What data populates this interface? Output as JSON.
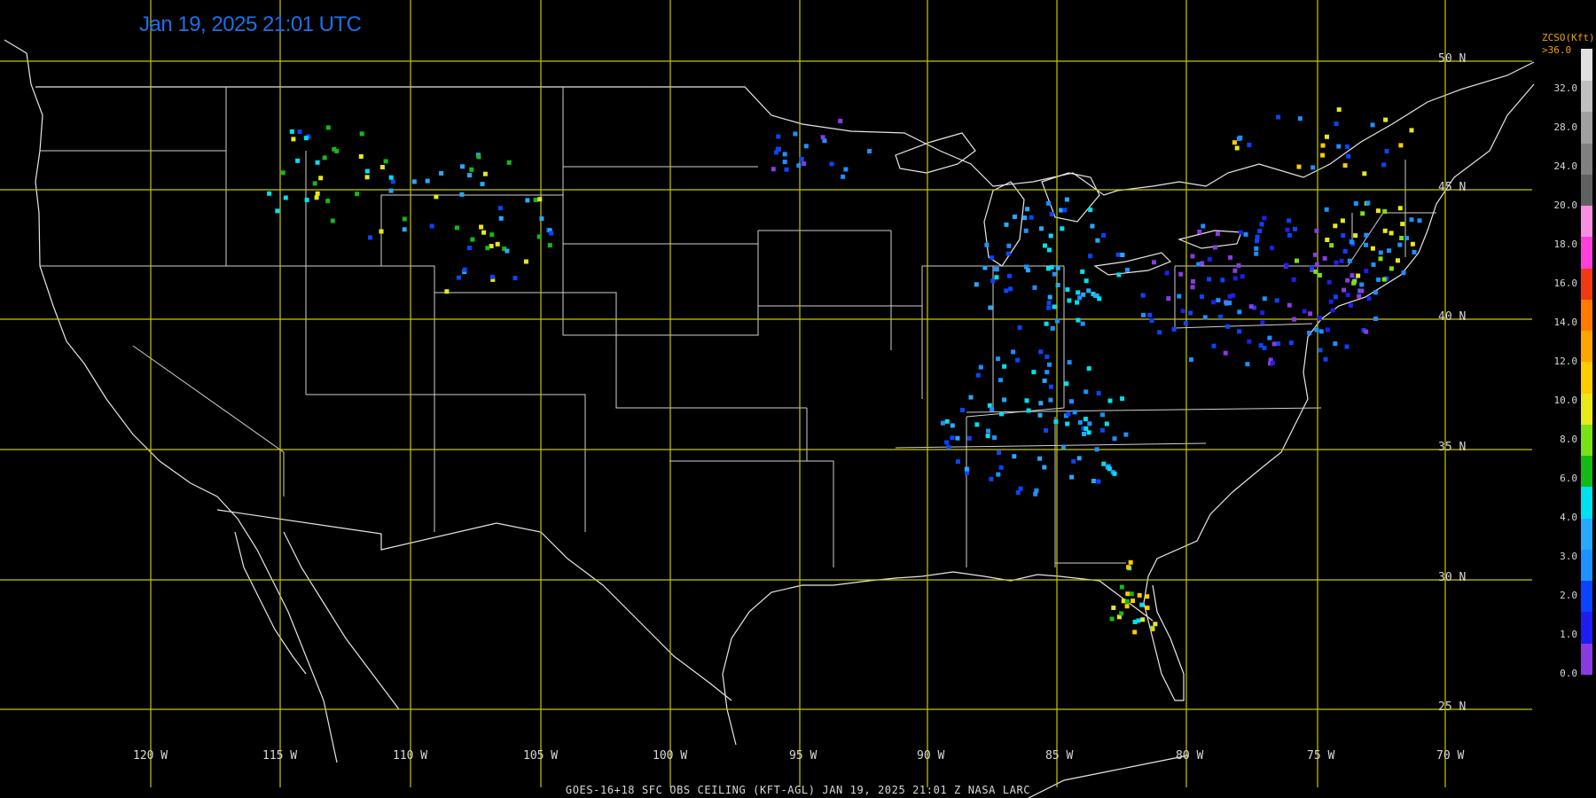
{
  "timestamp": "Jan 19, 2025 21:01 UTC",
  "footer": "GOES-16+18  SFC OBS CEILING (KFT-AGL)   JAN 19, 2025 21:01 Z   NASA LARC",
  "legend": {
    "title": "ZCSO(Kft)",
    "max_label": ">36.0",
    "ticks": [
      "32.0",
      "28.0",
      "24.0",
      "20.0",
      "18.0",
      "16.0",
      "14.0",
      "12.0",
      "10.0",
      "8.0",
      "6.0",
      "4.0",
      "3.0",
      "2.0",
      "1.0",
      "0.0"
    ],
    "colors": [
      "#8a3be0",
      "#1e1ef0",
      "#0a44ff",
      "#1e90ff",
      "#28a8ff",
      "#00e0f0",
      "#16b816",
      "#7ae01a",
      "#e8e81a",
      "#ffcc00",
      "#ffa500",
      "#ff7a00",
      "#f03a14",
      "#ff40d8",
      "#f890e0",
      "#606060",
      "#808080",
      "#a0a0a0",
      "#c0c0c0",
      "#e0e0e0"
    ]
  },
  "grid": {
    "lat_labels": [
      "50 N",
      "45 N",
      "40 N",
      "35 N",
      "30 N",
      "25 N"
    ],
    "lon_labels": [
      "120 W",
      "115 W",
      "110 W",
      "105 W",
      "100 W",
      "95 W",
      "90 W",
      "85 W",
      "80 W",
      "75 W",
      "70 W"
    ]
  }
}
